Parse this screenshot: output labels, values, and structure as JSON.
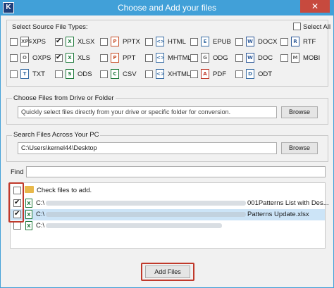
{
  "window": {
    "title": "Choose and Add your files",
    "app_icon": "K",
    "close": "✕"
  },
  "file_types": {
    "label": "Select Source File Types:",
    "select_all": "Select All",
    "items": [
      {
        "label": "XPS",
        "checked": false,
        "icon": "XPS",
        "color": "#6b6b6b"
      },
      {
        "label": "XLSX",
        "checked": true,
        "icon": "X",
        "color": "#1f7a3c"
      },
      {
        "label": "PPTX",
        "checked": false,
        "icon": "P",
        "color": "#c8502a"
      },
      {
        "label": "HTML",
        "checked": false,
        "icon": "<>",
        "color": "#3a6ea5"
      },
      {
        "label": "EPUB",
        "checked": false,
        "icon": "E",
        "color": "#3a6ea5"
      },
      {
        "label": "DOCX",
        "checked": false,
        "icon": "W",
        "color": "#2b5797"
      },
      {
        "label": "RTF",
        "checked": false,
        "icon": "R",
        "color": "#2b5797"
      },
      {
        "label": "OXPS",
        "checked": false,
        "icon": "O",
        "color": "#6b6b6b"
      },
      {
        "label": "XLS",
        "checked": true,
        "icon": "X",
        "color": "#1f7a3c"
      },
      {
        "label": "PPT",
        "checked": false,
        "icon": "P",
        "color": "#c8502a"
      },
      {
        "label": "MHTML",
        "checked": false,
        "icon": "<>",
        "color": "#3a6ea5"
      },
      {
        "label": "ODG",
        "checked": false,
        "icon": "G",
        "color": "#6b6b6b"
      },
      {
        "label": "DOC",
        "checked": false,
        "icon": "W",
        "color": "#2b5797"
      },
      {
        "label": "MOBI",
        "checked": false,
        "icon": "M",
        "color": "#6b6b6b"
      },
      {
        "label": "TXT",
        "checked": false,
        "icon": "T",
        "color": "#3a6ea5"
      },
      {
        "label": "ODS",
        "checked": false,
        "icon": "S",
        "color": "#1f7a3c"
      },
      {
        "label": "CSV",
        "checked": false,
        "icon": "C",
        "color": "#1f7a3c"
      },
      {
        "label": "XHTML",
        "checked": false,
        "icon": "<>",
        "color": "#3a6ea5"
      },
      {
        "label": "PDF",
        "checked": false,
        "icon": "A",
        "color": "#c0392b"
      },
      {
        "label": "ODT",
        "checked": false,
        "icon": "D",
        "color": "#3a6ea5"
      }
    ]
  },
  "drive": {
    "label": "Choose Files from Drive or Folder",
    "placeholder": "Quickly select files directly from your drive or specific folder for conversion.",
    "browse": "Browse"
  },
  "search": {
    "label": "Search Files Across Your PC",
    "value": "C:\\Users\\kernel44\\Desktop",
    "browse": "Browse"
  },
  "find": {
    "label": "Find :",
    "value": ""
  },
  "file_list": {
    "header": "Check files to add.",
    "rows": [
      {
        "prefix": "C:\\",
        "suffix": "001Patterns List with Des...",
        "checked": true,
        "selected": false
      },
      {
        "prefix": "C:\\",
        "suffix": "Patterns Update.xlsx",
        "checked": true,
        "selected": true
      },
      {
        "prefix": "C:\\",
        "suffix": "",
        "checked": false,
        "selected": false
      }
    ]
  },
  "add_files": "Add Files",
  "colors": {
    "titlebar": "#41a0d8",
    "highlight": "#c0392b",
    "selection": "#cce4f7"
  }
}
